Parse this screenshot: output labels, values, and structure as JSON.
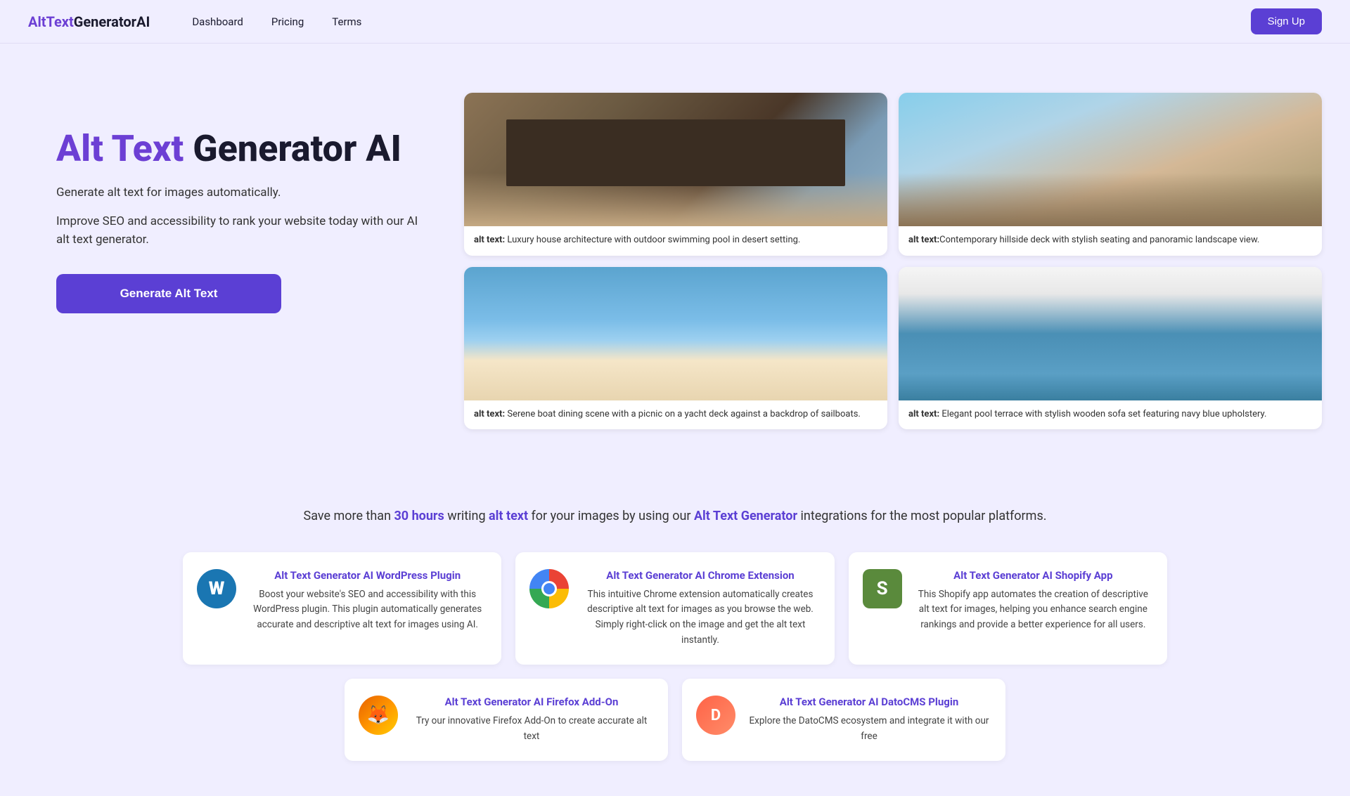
{
  "nav": {
    "logo": {
      "part1": "AltText",
      "part2": "GeneratorAI"
    },
    "links": [
      {
        "label": "Dashboard",
        "href": "#"
      },
      {
        "label": "Pricing",
        "href": "#"
      },
      {
        "label": "Terms",
        "href": "#"
      }
    ],
    "signup_label": "Sign Up"
  },
  "hero": {
    "title_purple": "Alt Text",
    "title_black": " Generator AI",
    "subtitle": "Generate alt text for images automatically.",
    "description": "Improve SEO and accessibility to rank your website today with our AI alt text generator.",
    "cta_label": "Generate Alt Text"
  },
  "image_cards": [
    {
      "alt_label": "alt text:",
      "caption": " Luxury house architecture with outdoor swimming pool in desert setting.",
      "bg_class": "img-desert"
    },
    {
      "alt_label": "alt text:",
      "caption": "Contemporary hillside deck with stylish seating and panoramic landscape view.",
      "bg_class": "img-hillside"
    },
    {
      "alt_label": "alt text:",
      "caption": " Serene boat dining scene with a picnic on a yacht deck against a backdrop of sailboats.",
      "bg_class": "img-boat"
    },
    {
      "alt_label": "alt text:",
      "caption": " Elegant pool terrace with stylish wooden sofa set featuring navy blue upholstery.",
      "bg_class": "img-pool"
    }
  ],
  "integrations": {
    "headline_prefix": "Save more than ",
    "headline_hours": "30 hours",
    "headline_mid": " writing ",
    "headline_alt": "alt text",
    "headline_mid2": " for your images by using our ",
    "headline_generator": "Alt Text Generator",
    "headline_suffix": " integrations for the most popular platforms.",
    "cards": [
      {
        "id": "wordpress",
        "title": "Alt Text Generator AI WordPress Plugin",
        "description": "Boost your website's SEO and accessibility with this WordPress plugin. This plugin automatically generates accurate and descriptive alt text for images using AI.",
        "icon_type": "wordpress"
      },
      {
        "id": "chrome",
        "title": "Alt Text Generator AI Chrome Extension",
        "description": "This intuitive Chrome extension automatically creates descriptive alt text for images as you browse the web. Simply right-click on the image and get the alt text instantly.",
        "icon_type": "chrome"
      },
      {
        "id": "shopify",
        "title": "Alt Text Generator AI Shopify App",
        "description": "This Shopify app automates the creation of descriptive alt text for images, helping you enhance search engine rankings and provide a better experience for all users.",
        "icon_type": "shopify"
      },
      {
        "id": "firefox",
        "title": "Alt Text Generator AI Firefox Add-On",
        "description": "Try our innovative Firefox Add-On to create accurate alt text",
        "icon_type": "firefox"
      },
      {
        "id": "datocms",
        "title": "Alt Text Generator AI DatoCMS Plugin",
        "description": "Explore the DatoCMS ecosystem and integrate it with our free",
        "icon_type": "datocms"
      }
    ]
  }
}
